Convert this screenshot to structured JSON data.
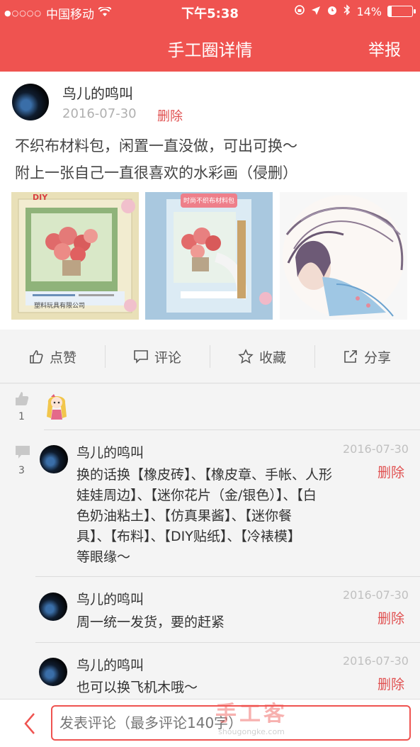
{
  "status_bar": {
    "carrier": "中国移动",
    "time": "下午5:38",
    "battery": "14%",
    "battery_level": 0.14
  },
  "nav": {
    "title": "手工圈详情",
    "report_label": "举报"
  },
  "post": {
    "author": "鸟儿的鸣叫",
    "date": "2016-07-30",
    "delete_label": "删除",
    "text_line1": "不织布材料包，闲置一直没做，可出可换～",
    "text_line2": "附上一张自己一直很喜欢的水彩画（侵删）",
    "images": [
      {
        "label": "DIY",
        "caption": "塑料玩具有限公司"
      },
      {
        "label": "时尚不织布材料包"
      },
      {}
    ]
  },
  "actions": {
    "like": "点赞",
    "comment": "评论",
    "favorite": "收藏",
    "share": "分享"
  },
  "likes": {
    "count": "1"
  },
  "comments": {
    "count": "3",
    "items": [
      {
        "author": "鸟儿的鸣叫",
        "date": "2016-07-30",
        "delete_label": "删除",
        "lines": [
          "换的话换【橡皮砖】、【橡皮章、手帐、人形",
          "娃娃周边】、【迷你花片（金/银色）】、【白",
          "色奶油粘土】、【仿真果酱】、【迷你餐",
          "具】、【布料】、【DIY贴纸】、【冷裱模】",
          "等眼缘～"
        ]
      },
      {
        "author": "鸟儿的鸣叫",
        "date": "2016-07-30",
        "delete_label": "删除",
        "lines": [
          "周一统一发货，要的赶紧"
        ]
      },
      {
        "author": "鸟儿的鸣叫",
        "date": "2016-07-30",
        "delete_label": "删除",
        "lines": [
          "也可以换飞机木哦～"
        ]
      }
    ]
  },
  "bottom": {
    "comment_placeholder": "发表评论（最多评论140字）",
    "watermark_big": "手工客",
    "watermark_small": "shougongke.com"
  },
  "colors": {
    "brand_red": "#ef5350",
    "delete_red": "#e05050"
  }
}
